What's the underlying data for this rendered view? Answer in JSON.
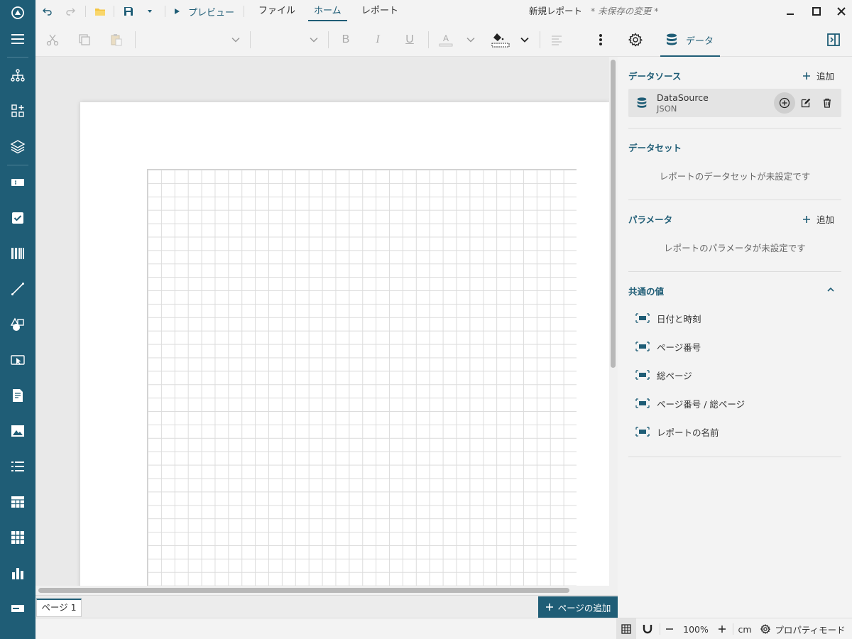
{
  "titlebar": {
    "preview_label": "プレビュー",
    "menu_tabs": [
      "ファイル",
      "ホーム",
      "レポート"
    ],
    "active_tab": "ホーム",
    "document_title": "新規レポート",
    "unsaved_label": "* 未保存の変更 *"
  },
  "toolbar": {
    "data_tab_label": "データ"
  },
  "rail": {
    "icons": [
      "menu-icon",
      "report-explorer-icon",
      "group-icon",
      "layers-icon",
      "textbox-icon",
      "checkbox-icon",
      "barcode-icon",
      "line-icon",
      "shape-icon",
      "input-field-icon",
      "richtext-icon",
      "image-icon",
      "list-icon",
      "table-icon",
      "tablix-icon",
      "chart-icon",
      "banded-list-icon"
    ]
  },
  "canvas": {
    "page_tab_label": "ページ 1",
    "add_page_label": "ページの追加"
  },
  "statusbar": {
    "zoom": "100%",
    "unit": "cm",
    "property_mode_label": "プロパティモード"
  },
  "panel": {
    "datasource_header": "データソース",
    "add_label": "追加",
    "datasource": {
      "name": "DataSource",
      "type": "JSON"
    },
    "dataset_header": "データセット",
    "dataset_empty": "レポートのデータセットが未設定です",
    "parameters_header": "パラメータ",
    "parameters_empty": "レポートのパラメータが未設定です",
    "common_header": "共通の値",
    "common_items": [
      "日付と時刻",
      "ページ番号",
      "総ページ",
      "ページ番号 / 総ページ",
      "レポートの名前"
    ]
  },
  "colors": {
    "accent": "#1f5d76",
    "rail": "#1f5d76"
  }
}
